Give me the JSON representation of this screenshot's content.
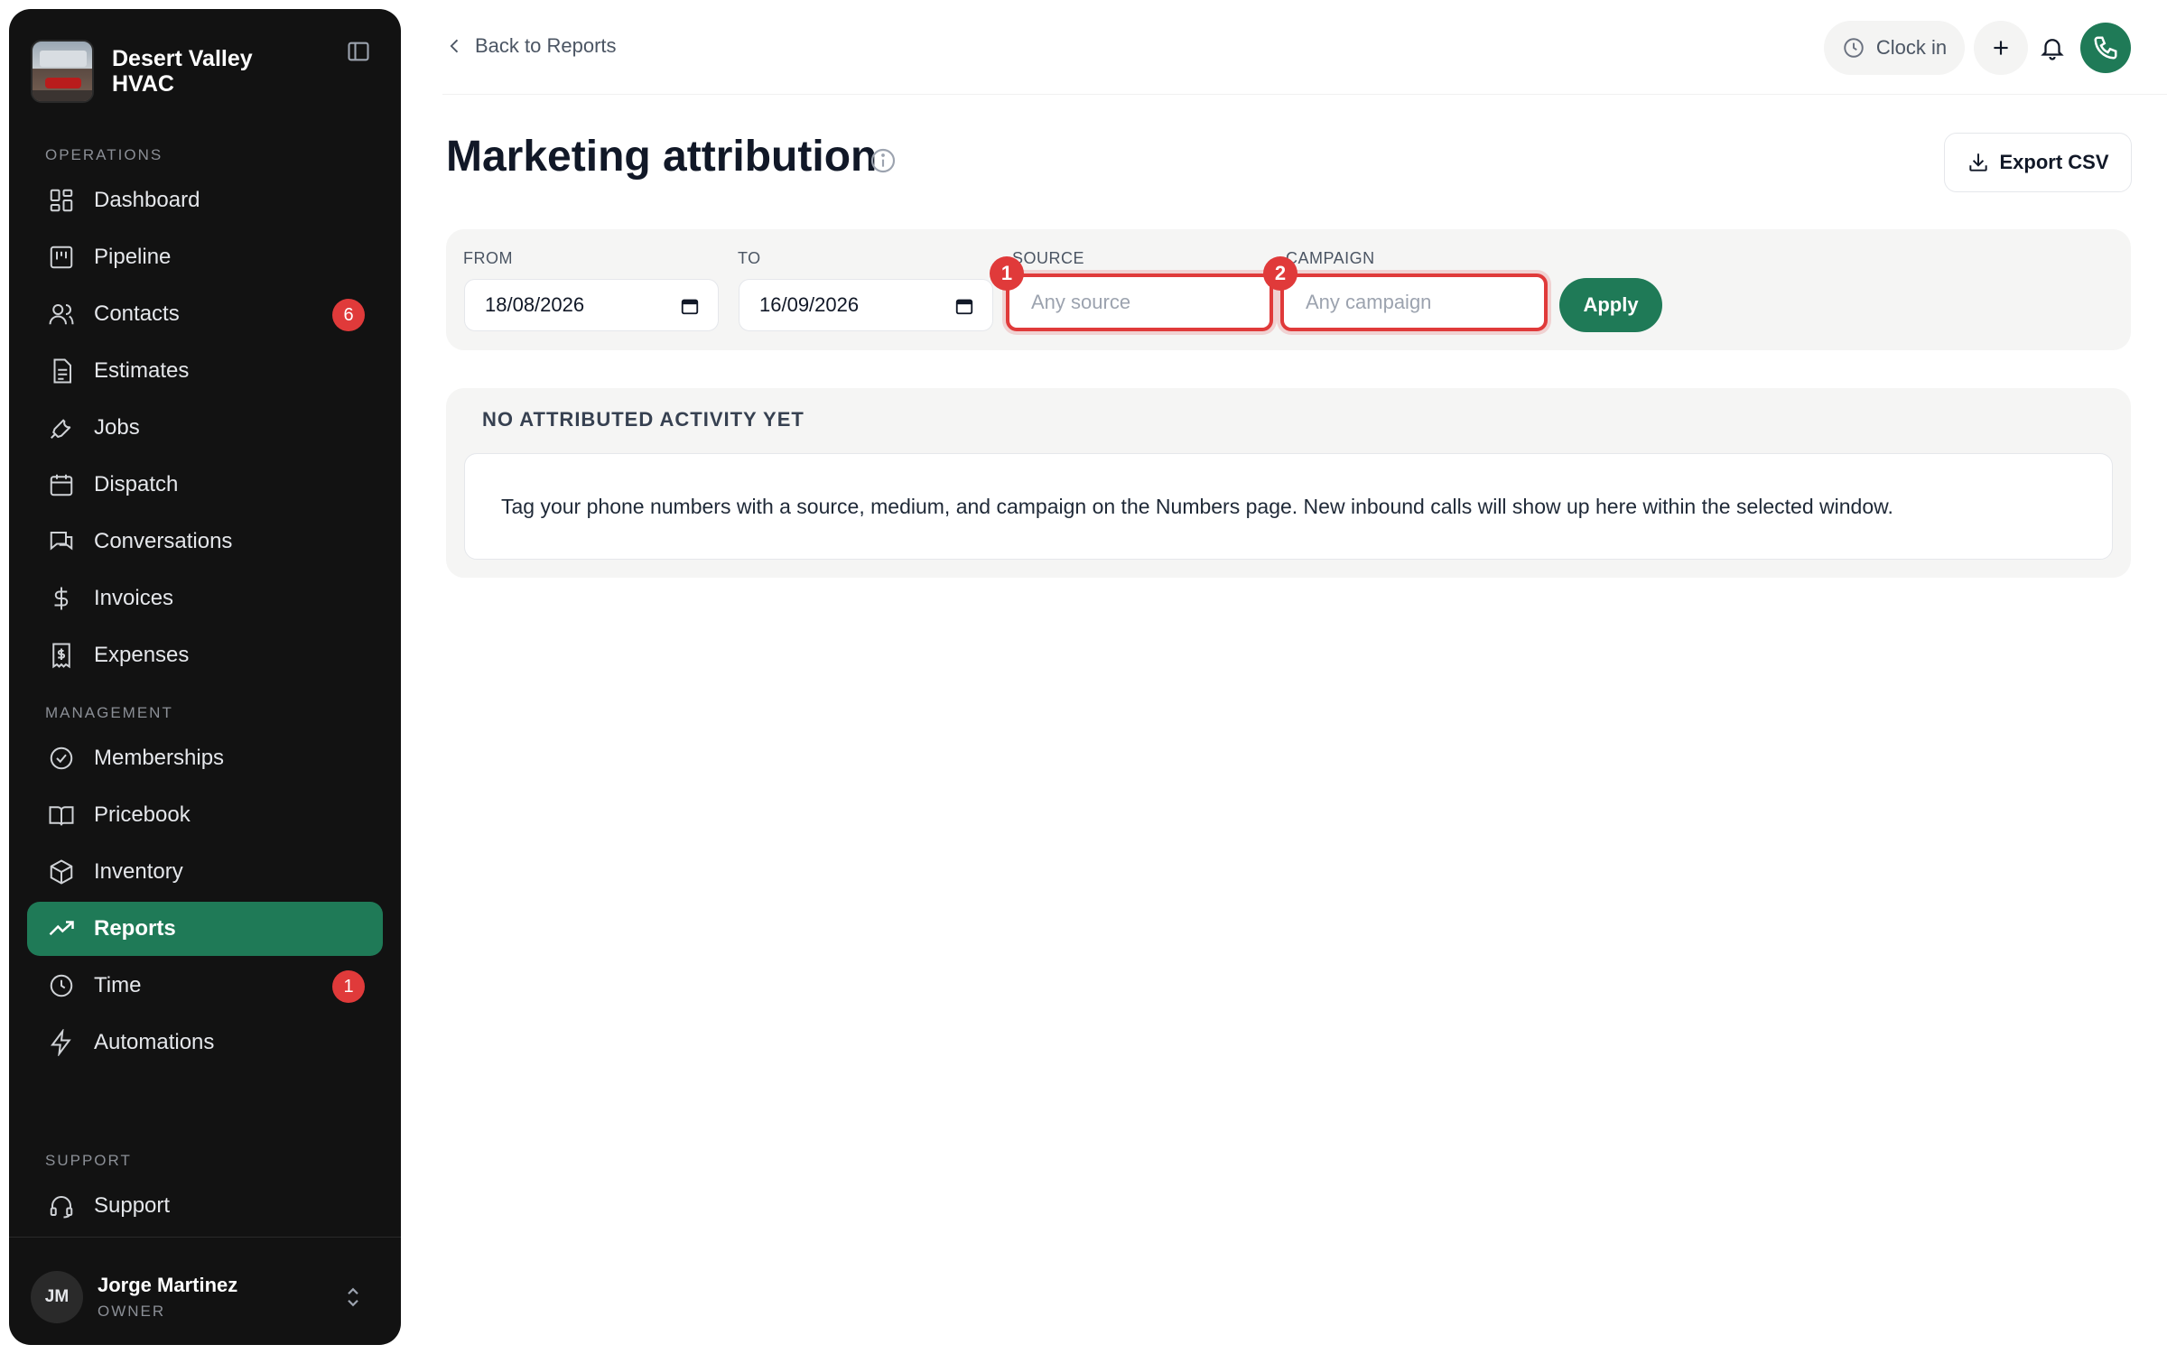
{
  "sidebar": {
    "brand": "Desert Valley HVAC",
    "sections": {
      "operations": "OPERATIONS",
      "management": "MANAGEMENT",
      "support": "SUPPORT"
    },
    "items": [
      {
        "label": "Dashboard",
        "icon": "dashboard-icon"
      },
      {
        "label": "Pipeline",
        "icon": "pipeline-icon"
      },
      {
        "label": "Contacts",
        "icon": "contacts-icon",
        "badge": "6"
      },
      {
        "label": "Estimates",
        "icon": "document-icon"
      },
      {
        "label": "Jobs",
        "icon": "wrench-icon"
      },
      {
        "label": "Dispatch",
        "icon": "calendar-icon"
      },
      {
        "label": "Conversations",
        "icon": "chat-icon"
      },
      {
        "label": "Invoices",
        "icon": "dollar-icon"
      },
      {
        "label": "Expenses",
        "icon": "receipt-icon"
      },
      {
        "label": "Memberships",
        "icon": "check-badge-icon"
      },
      {
        "label": "Pricebook",
        "icon": "book-icon"
      },
      {
        "label": "Inventory",
        "icon": "box-icon"
      },
      {
        "label": "Reports",
        "icon": "trending-icon",
        "active": true
      },
      {
        "label": "Time",
        "icon": "clock-icon",
        "badge": "1"
      },
      {
        "label": "Automations",
        "icon": "bolt-icon"
      },
      {
        "label": "Support",
        "icon": "headset-icon"
      }
    ],
    "user": {
      "initials": "JM",
      "name": "Jorge Martinez",
      "role": "OWNER"
    }
  },
  "topbar": {
    "back_label": "Back to Reports",
    "clock_in_label": "Clock in"
  },
  "page": {
    "title": "Marketing attribution",
    "export_label": "Export CSV"
  },
  "filters": {
    "from_label": "FROM",
    "from_value": "18/08/2026",
    "to_label": "TO",
    "to_value": "16/09/2026",
    "source_label": "SOURCE",
    "source_placeholder": "Any source",
    "campaign_label": "CAMPAIGN",
    "campaign_placeholder": "Any campaign",
    "apply_label": "Apply",
    "markers": [
      "1",
      "2"
    ]
  },
  "empty_state": {
    "title": "NO ATTRIBUTED ACTIVITY YET",
    "message": "Tag your phone numbers with a source, medium, and campaign on the Numbers page. New inbound calls will show up here within the selected window."
  },
  "colors": {
    "sidebar_bg": "#121212",
    "accent": "#1f7a57",
    "badge": "#e03a3a"
  }
}
